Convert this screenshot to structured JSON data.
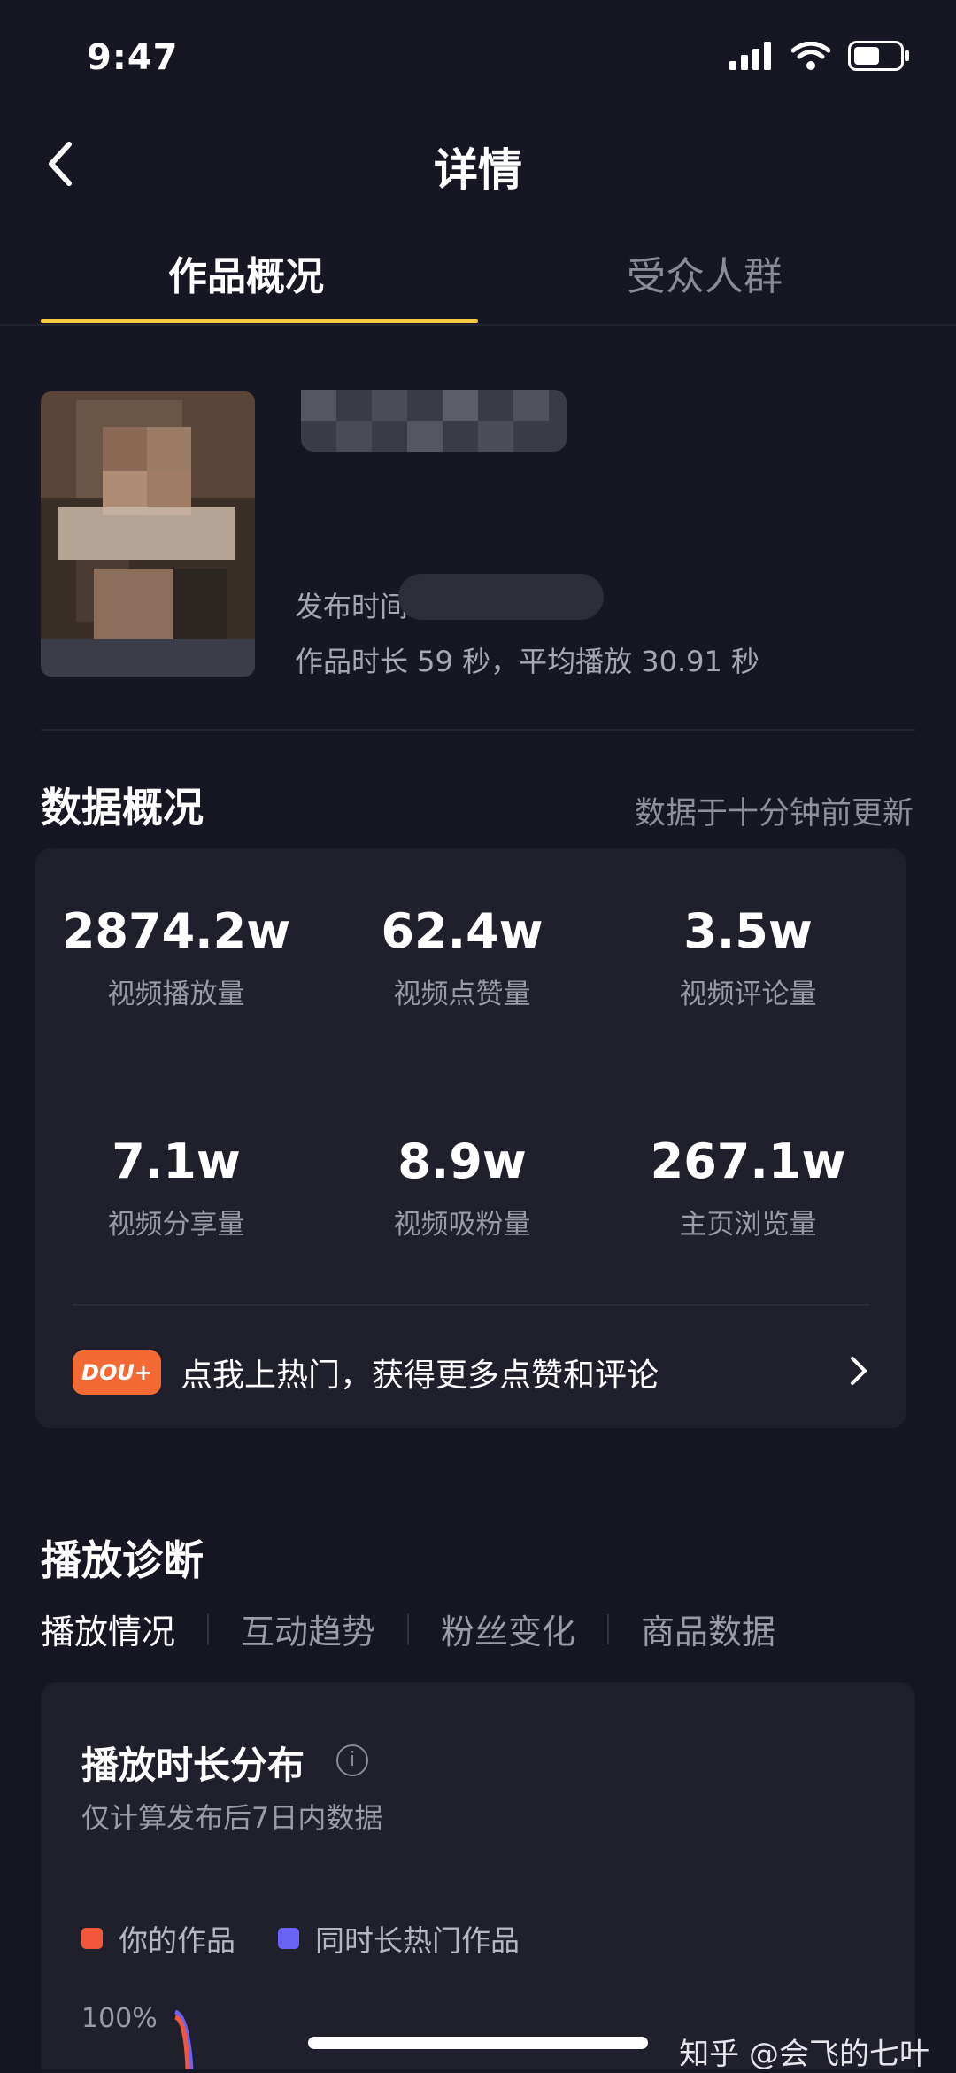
{
  "status_bar": {
    "time": "9:47"
  },
  "nav": {
    "title": "详情"
  },
  "tabs": [
    {
      "label": "作品概况"
    },
    {
      "label": "受众人群"
    }
  ],
  "video": {
    "publish_label": "发布时间",
    "duration_line": "作品时长 59 秒，平均播放 30.91 秒"
  },
  "overview": {
    "title": "数据概况",
    "updated": "数据于十分钟前更新",
    "stats": [
      {
        "value": "2874.2w",
        "label": "视频播放量"
      },
      {
        "value": "62.4w",
        "label": "视频点赞量"
      },
      {
        "value": "3.5w",
        "label": "视频评论量"
      },
      {
        "value": "7.1w",
        "label": "视频分享量"
      },
      {
        "value": "8.9w",
        "label": "视频吸粉量"
      },
      {
        "value": "267.1w",
        "label": "主页浏览量"
      }
    ],
    "promo_badge": "DOU+",
    "promo_text": "点我上热门，获得更多点赞和评论"
  },
  "diagnosis": {
    "title": "播放诊断",
    "tabs": [
      "播放情况",
      "互动趋势",
      "粉丝变化",
      "商品数据"
    ],
    "chart_title": "播放时长分布",
    "chart_subtitle": "仅计算发布后7日内数据",
    "legend": [
      {
        "name": "你的作品",
        "color": "#f2573a"
      },
      {
        "name": "同时长热门作品",
        "color": "#6b63f5"
      }
    ],
    "y_top_label": "100%"
  },
  "watermark": "知乎 @会飞的七叶"
}
